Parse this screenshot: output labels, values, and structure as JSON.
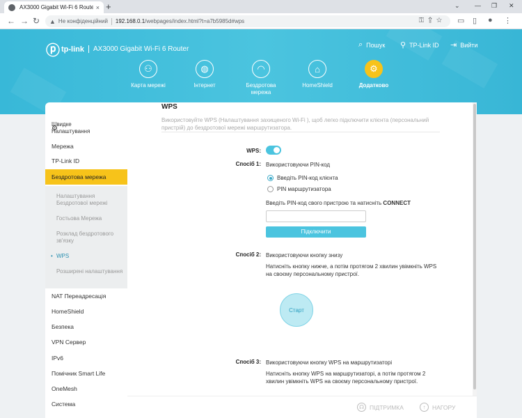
{
  "browser": {
    "tab_title": "AX3000 Gigabit Wi-Fi 6 Router",
    "tab_close": "×",
    "new_tab": "+",
    "not_secure": "Не конфіденційний",
    "url_host": "192.168.0.1",
    "url_path": "/webpages/index.html?t=a7b5985d#wps"
  },
  "header": {
    "logo_text": "tp-link",
    "model": "AX3000 Gigabit Wi-Fi 6 Router",
    "links": [
      {
        "label": "Пошук",
        "icon": "search-icon"
      },
      {
        "label": "TP-Link ID",
        "icon": "tplink-id-icon"
      },
      {
        "label": "Вийти",
        "icon": "logout-icon"
      }
    ],
    "nav": [
      {
        "label": "Карта мережі",
        "icon": "network-map-icon"
      },
      {
        "label": "Інтернет",
        "icon": "globe-icon"
      },
      {
        "label": "Бездротова мережа",
        "icon": "wifi-icon"
      },
      {
        "label": "HomeShield",
        "icon": "homeshield-icon"
      },
      {
        "label": "Додатково",
        "icon": "gear-icon",
        "active": true
      }
    ]
  },
  "sidebar": {
    "quick_setup": "Швидке Налаштування",
    "items": {
      "network": "Мережа",
      "tplink_id": "TP-Link ID",
      "wireless": "Бездротова мережа",
      "nat": "NAT Переадресація",
      "homeshield": "HomeShield",
      "security": "Безпека",
      "vpn": "VPN Сервер",
      "ipv6": "IPv6",
      "smartlife": "Помічник Smart Life",
      "onemesh": "OneMesh",
      "system": "Система"
    },
    "sub": {
      "wireless_settings": "Налаштування Бездротової мережі",
      "guest": "Гостьова Мережа",
      "schedule": "Розклад бездротового зв'язку",
      "wps": "WPS",
      "advanced": "Розширені налаштування"
    }
  },
  "wps": {
    "title": "WPS",
    "description": "Використовуйте WPS (Налаштування захищеного Wi-Fi ), щоб легко підключити клієнта (персональний пристрій) до бездротової мережі маршрутизатора.",
    "toggle_label": "WPS:",
    "toggle_on": true,
    "method1_label": "Спосіб 1:",
    "method1_text": "Використовуючи PIN-код",
    "radio_client": "Введіть PIN-код клієнта",
    "radio_router": "PIN маршрутизатора",
    "selected_radio": "client",
    "pin_prompt": "Введіть PIN-код свого пристрою та натисніть",
    "pin_prompt_bold": "CONNECT",
    "pin_value": "",
    "connect_button": "Підключити",
    "method2_label": "Спосіб 2:",
    "method2_text": "Використовуючи кнопку знизу",
    "method2_desc": "Натисніть кнопку нижче, а потім протягом 2 хвилин увімкніть WPS на своєму персональному пристрої.",
    "start_button": "Старт",
    "method3_label": "Спосіб 3:",
    "method3_text": "Використовуючи кнопку WPS на маршрутизаторі",
    "method3_desc": "Натисніть кнопку WPS на маршрутизаторі, а потім протягом 2 хвилин увімкніть WPS на своєму персональному пристрої."
  },
  "footer": {
    "support": "ПІДТРИМКА",
    "top": "НАГОРУ"
  },
  "colors": {
    "accent": "#4bc4df",
    "active": "#f7c31a"
  }
}
